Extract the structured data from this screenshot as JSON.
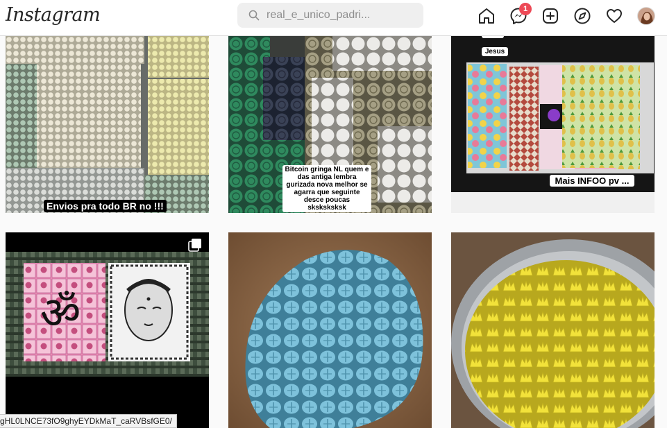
{
  "header": {
    "logo": "Instagram",
    "search_value": "real_e_unico_padri..."
  },
  "nav": {
    "icons": [
      "home-icon",
      "messenger-icon",
      "new-post-icon",
      "explore-icon",
      "activity-heart-icon",
      "profile-avatar"
    ],
    "messages_badge": "1"
  },
  "posts": [
    {
      "caption": "Envios pra todo BR no !!!"
    },
    {
      "caption": "Bitcoin gringa NL quem e das antiga lembra gurizada nova melhor se agarra que seguinte desce poucas sksksksksk"
    },
    {
      "caption_top_1": "Jesus",
      "caption_bottom": "Mais INFOO pv ..."
    },
    {
      "multi_icon": "carousel-icon"
    },
    {},
    {}
  ],
  "status_bar": {
    "url": "gHL0LNCE73fO9ghyEYDkMaT_caRVBsfGE0/"
  },
  "colors": {
    "badge": "#ed4956",
    "text": "#262626",
    "background": "#fafafa"
  }
}
